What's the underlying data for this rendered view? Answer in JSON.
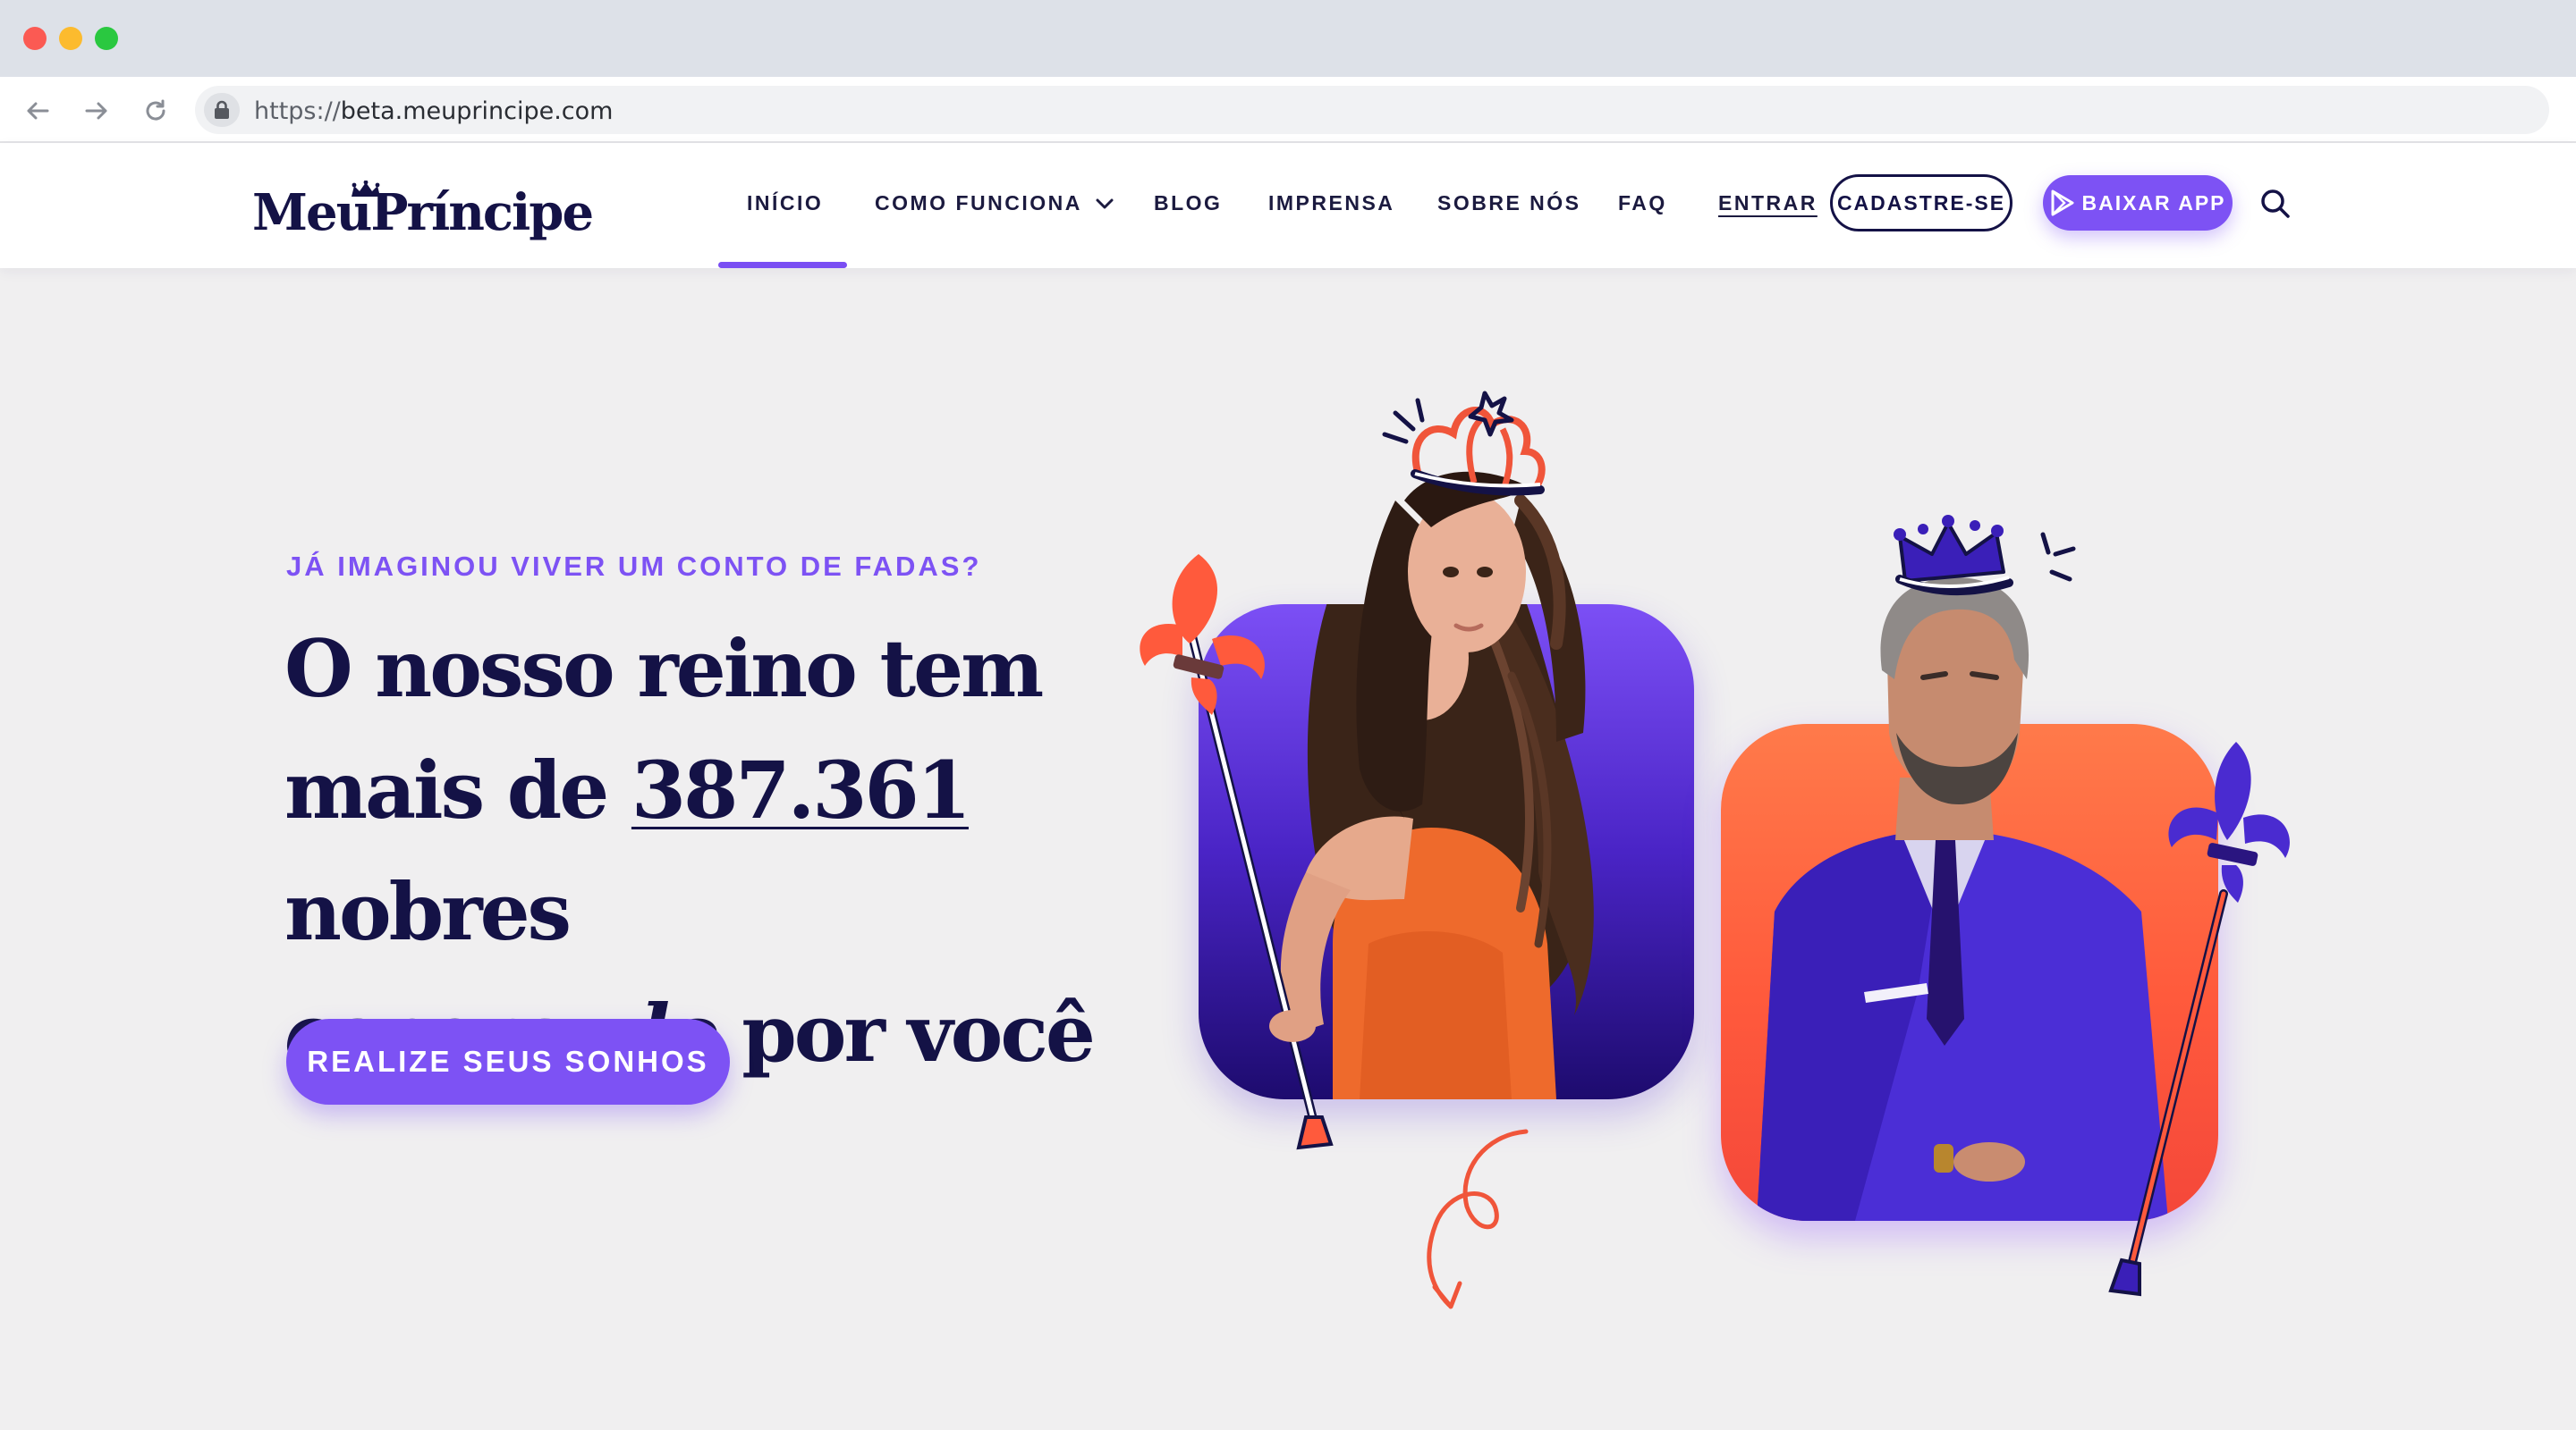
{
  "browser": {
    "url_protocol": "https://",
    "url_host": "beta.meuprincipe.com"
  },
  "header": {
    "logo_text": "MeuPríncipe",
    "nav": [
      {
        "label": "INÍCIO",
        "active": true
      },
      {
        "label": "COMO FUNCIONA",
        "has_dropdown": true
      },
      {
        "label": "BLOG"
      },
      {
        "label": "IMPRENSA"
      },
      {
        "label": "SOBRE NÓS"
      },
      {
        "label": "FAQ"
      },
      {
        "label": "ENTRAR"
      }
    ],
    "signup_label": "CADASTRE-SE",
    "app_label": "BAIXAR APP"
  },
  "hero": {
    "eyebrow": "JÁ IMAGINOU VIVER UM CONTO DE FADAS?",
    "line1": "O nosso reino tem",
    "line2_pre": "mais de ",
    "count": "387.361",
    "line2_post": " nobres",
    "line3_italic": "esperando",
    "line3_post": " por você",
    "cta_label": "REALIZE SEUS SONHOS"
  },
  "colors": {
    "brand_navy": "#141246",
    "brand_purple": "#7d52f4",
    "accent_orange": "#ff5a3c",
    "page_bg": "#f0eff0"
  },
  "icons": [
    "arrow-left-icon",
    "arrow-right-icon",
    "reload-icon",
    "lock-icon",
    "chevron-down-icon",
    "play-store-icon",
    "search-icon",
    "crown-icon",
    "fleur-de-lis-icon",
    "curly-arrow-icon"
  ]
}
